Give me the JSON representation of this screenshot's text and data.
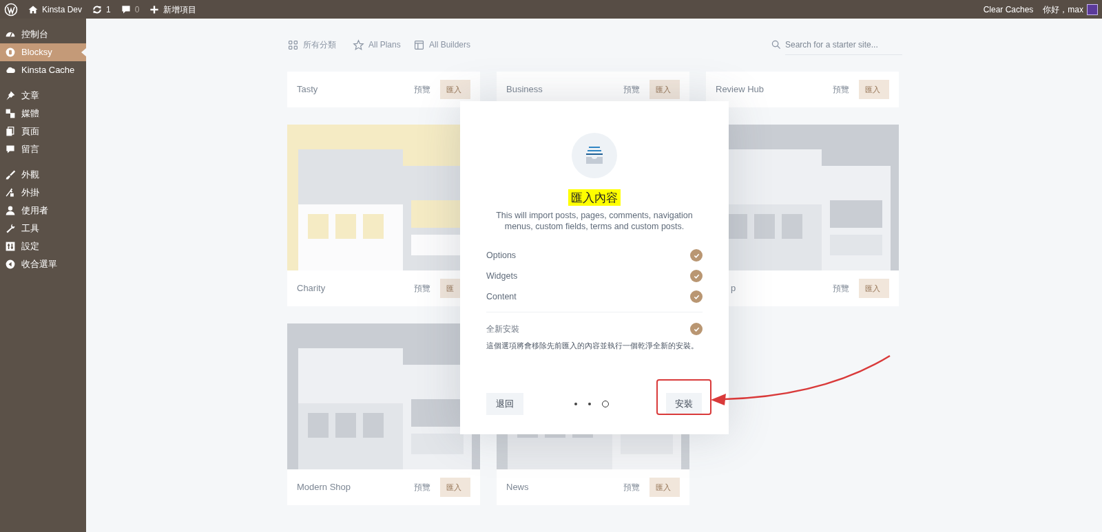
{
  "admin_bar": {
    "left": [
      {
        "kind": "wp"
      },
      {
        "kind": "home",
        "label": "Kinsta Dev"
      },
      {
        "kind": "updates",
        "label": "1"
      },
      {
        "kind": "comments",
        "label": "0"
      },
      {
        "kind": "new",
        "label": "新增項目"
      }
    ],
    "right": [
      {
        "kind": "text",
        "label": "Clear Caches"
      },
      {
        "kind": "account",
        "label": "你好，max"
      }
    ]
  },
  "sidebar": {
    "items": [
      {
        "kind": "dashboard",
        "label": "控制台",
        "selected": false
      },
      {
        "kind": "blocksy",
        "label": "Blocksy",
        "selected": true
      },
      {
        "kind": "cloud",
        "label": "Kinsta Cache",
        "selected": false
      },
      {
        "kind": "pin",
        "label": "文章",
        "selected": false,
        "group_start": true
      },
      {
        "kind": "media",
        "label": "媒體",
        "selected": false
      },
      {
        "kind": "pages",
        "label": "頁面",
        "selected": false
      },
      {
        "kind": "comment",
        "label": "留言",
        "selected": false
      },
      {
        "kind": "brush",
        "label": "外觀",
        "selected": false,
        "group_start": true
      },
      {
        "kind": "plug",
        "label": "外掛",
        "selected": false
      },
      {
        "kind": "user",
        "label": "使用者",
        "selected": false
      },
      {
        "kind": "wrench",
        "label": "工具",
        "selected": false
      },
      {
        "kind": "settings",
        "label": "設定",
        "selected": false
      },
      {
        "kind": "collapse",
        "label": "收合選單",
        "selected": false
      }
    ]
  },
  "filters": [
    {
      "kind": "grid",
      "label": "所有分類"
    },
    {
      "kind": "star",
      "label": "All Plans"
    },
    {
      "kind": "layout",
      "label": "All Builders"
    }
  ],
  "search": {
    "placeholder": "Search for a starter site..."
  },
  "card_rows": [
    [
      {
        "kind": "footer",
        "title": "Tasty",
        "preview": "預覽",
        "import": "匯入"
      },
      {
        "kind": "footer",
        "title": "Business",
        "preview": "預覽",
        "import": "匯入"
      },
      {
        "kind": "footer",
        "title": "Review Hub",
        "preview": "預覽",
        "import": "匯入"
      }
    ],
    [
      {
        "kind": "full",
        "title": "Charity",
        "preview": "預覽",
        "import": "匯"
      },
      {
        "kind": "covered"
      },
      {
        "kind": "full",
        "title": "p",
        "preview": "預覽",
        "import": "匯入"
      }
    ],
    [
      {
        "kind": "full",
        "title": "Modern Shop",
        "preview": "預覽",
        "import": "匯入"
      },
      {
        "kind": "full",
        "title": "News",
        "preview": "預覽",
        "import": "匯入"
      }
    ]
  ],
  "modal": {
    "title": "匯入內容",
    "description": "This will import posts, pages, comments, navigation menus, custom fields, terms and custom posts.",
    "options": [
      {
        "label": "Options",
        "checked": true
      },
      {
        "label": "Widgets",
        "checked": true
      },
      {
        "label": "Content",
        "checked": true
      }
    ],
    "clean_install": {
      "label": "全新安裝",
      "checked": true,
      "note": "這個選項將會移除先前匯入的內容並執行一個乾淨全新的安裝。"
    },
    "back_button": "退回",
    "steps": [
      {
        "selected": false
      },
      {
        "selected": false
      },
      {
        "selected": true
      }
    ],
    "install_button": "安裝"
  }
}
